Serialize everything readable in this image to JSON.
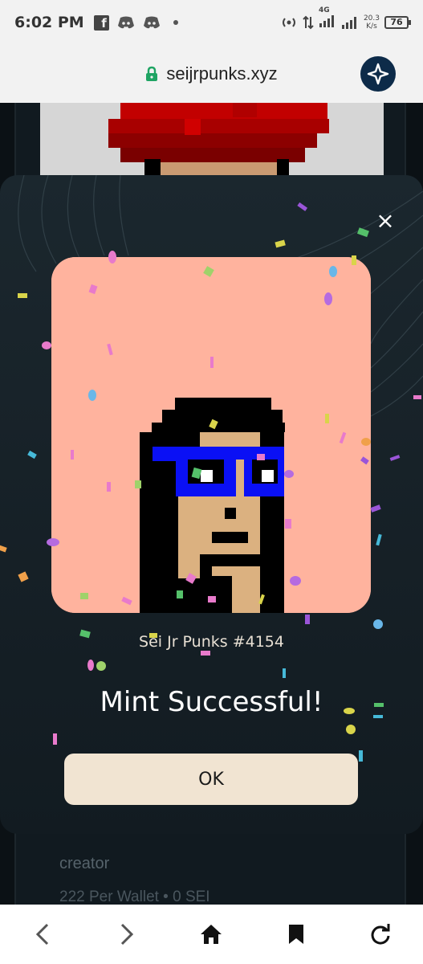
{
  "status_bar": {
    "time": "6:02 PM",
    "network": "4G",
    "net_speed_value": "20.3",
    "net_speed_unit": "K/s",
    "battery": "76"
  },
  "browser": {
    "url": "seijrpunks.xyz"
  },
  "modal": {
    "close_label": "×",
    "nft_name": "Sei Jr Punks #4154",
    "heading": "Mint Successful!",
    "ok_label": "OK"
  },
  "page_behind": {
    "creator_label": "creator",
    "wallet_info": "222 Per Wallet • 0 SEI"
  },
  "colors": {
    "modal_bg": "#1b272e",
    "nft_bg": "#ffb39e",
    "ok_button_bg": "#f1e4d2",
    "browser_accent": "#0d2b49",
    "glasses": "#0a10f5",
    "skin": "#dbb180",
    "hair": "#000000"
  },
  "icons": [
    "facebook-icon",
    "discord-icon",
    "hotspot-icon",
    "signal-icon",
    "battery-icon",
    "lock-icon",
    "extension-icon",
    "close-icon",
    "back-icon",
    "forward-icon",
    "home-icon",
    "bookmark-icon",
    "reload-icon"
  ]
}
